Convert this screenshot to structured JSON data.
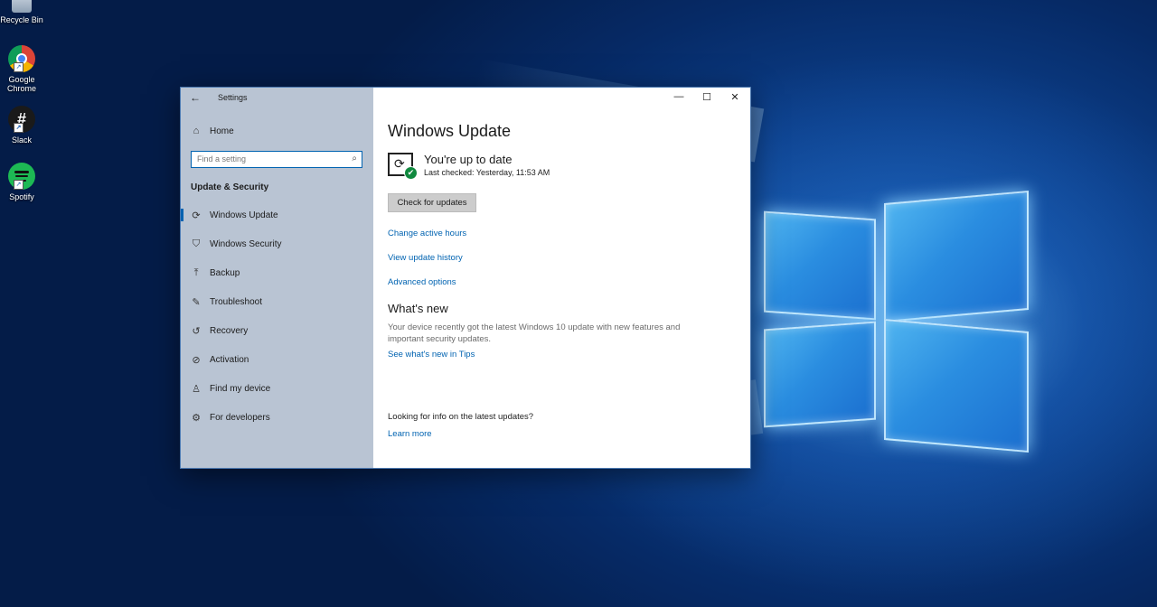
{
  "desktop": {
    "icons": [
      {
        "label": "Recycle Bin"
      },
      {
        "label": "Google Chrome"
      },
      {
        "label": "Slack"
      },
      {
        "label": "Spotify"
      }
    ]
  },
  "window": {
    "title": "Settings",
    "back_icon": "back-arrow-icon",
    "controls": {
      "minimize": "—",
      "maximize": "☐",
      "close": "✕"
    }
  },
  "sidebar": {
    "home": "Home",
    "search": {
      "placeholder": "Find a setting"
    },
    "section_title": "Update & Security",
    "items": [
      {
        "label": "Windows Update",
        "icon": "sync-icon",
        "active": true
      },
      {
        "label": "Windows Security",
        "icon": "shield-icon"
      },
      {
        "label": "Backup",
        "icon": "backup-icon"
      },
      {
        "label": "Troubleshoot",
        "icon": "wrench-icon"
      },
      {
        "label": "Recovery",
        "icon": "recovery-icon"
      },
      {
        "label": "Activation",
        "icon": "activation-icon"
      },
      {
        "label": "Find my device",
        "icon": "person-icon"
      },
      {
        "label": "For developers",
        "icon": "developer-icon"
      }
    ]
  },
  "main": {
    "title": "Windows Update",
    "status": {
      "title": "You're up to date",
      "last_checked": "Last checked: Yesterday, 11:53 AM"
    },
    "check_button": "Check for updates",
    "links": [
      "Change active hours",
      "View update history",
      "Advanced options"
    ],
    "whats_new": {
      "heading": "What's new",
      "body": "Your device recently got the latest Windows 10 update with new features and important security updates.",
      "link": "See what's new in Tips"
    },
    "info": {
      "question": "Looking for info on the latest updates?",
      "link": "Learn more"
    }
  },
  "colors": {
    "accent": "#0063b1",
    "sidebar_bg": "#b9c4d3",
    "success": "#10893e"
  }
}
